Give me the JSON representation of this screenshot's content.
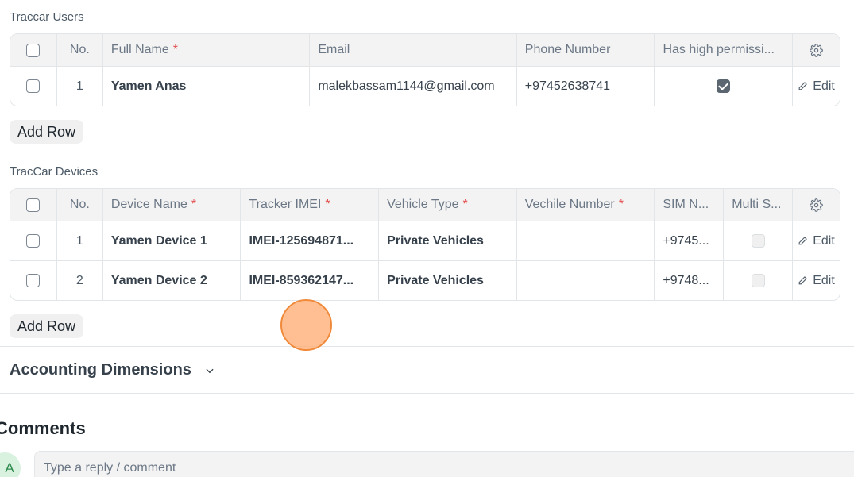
{
  "traccar_users": {
    "label": "Traccar Users",
    "columns": {
      "no": "No.",
      "full_name": "Full Name",
      "email": "Email",
      "phone": "Phone Number",
      "perm": "Has high permissi..."
    },
    "required_mark": "*",
    "rows": [
      {
        "no": "1",
        "full_name": "Yamen Anas",
        "email": "malekbassam1144@gmail.com",
        "phone": "+97452638741",
        "perm_checked": true,
        "edit": "Edit"
      }
    ],
    "add_row": "Add Row"
  },
  "traccar_devices": {
    "label": "TracCar Devices",
    "columns": {
      "no": "No.",
      "device_name": "Device Name",
      "imei": "Tracker IMEI",
      "vehicle_type": "Vehicle Type",
      "vehicle_number": "Vechile Number",
      "sim": "SIM N...",
      "multi": "Multi S..."
    },
    "required_mark": "*",
    "rows": [
      {
        "no": "1",
        "device_name": "Yamen Device 1",
        "imei": "IMEI-125694871...",
        "vehicle_type": "Private Vehicles",
        "vehicle_number": "",
        "sim": "+9745...",
        "edit": "Edit"
      },
      {
        "no": "2",
        "device_name": "Yamen Device 2",
        "imei": "IMEI-859362147...",
        "vehicle_type": "Private Vehicles",
        "vehicle_number": "",
        "sim": "+9748...",
        "edit": "Edit"
      }
    ],
    "add_row": "Add Row"
  },
  "accounting": {
    "title": "Accounting Dimensions"
  },
  "comments": {
    "title": "Comments",
    "avatar_initial": "A",
    "placeholder": "Type a reply / comment"
  },
  "icons": {
    "settings": "gear-icon",
    "edit": "pencil-icon",
    "expand": "chevron-down-icon"
  }
}
